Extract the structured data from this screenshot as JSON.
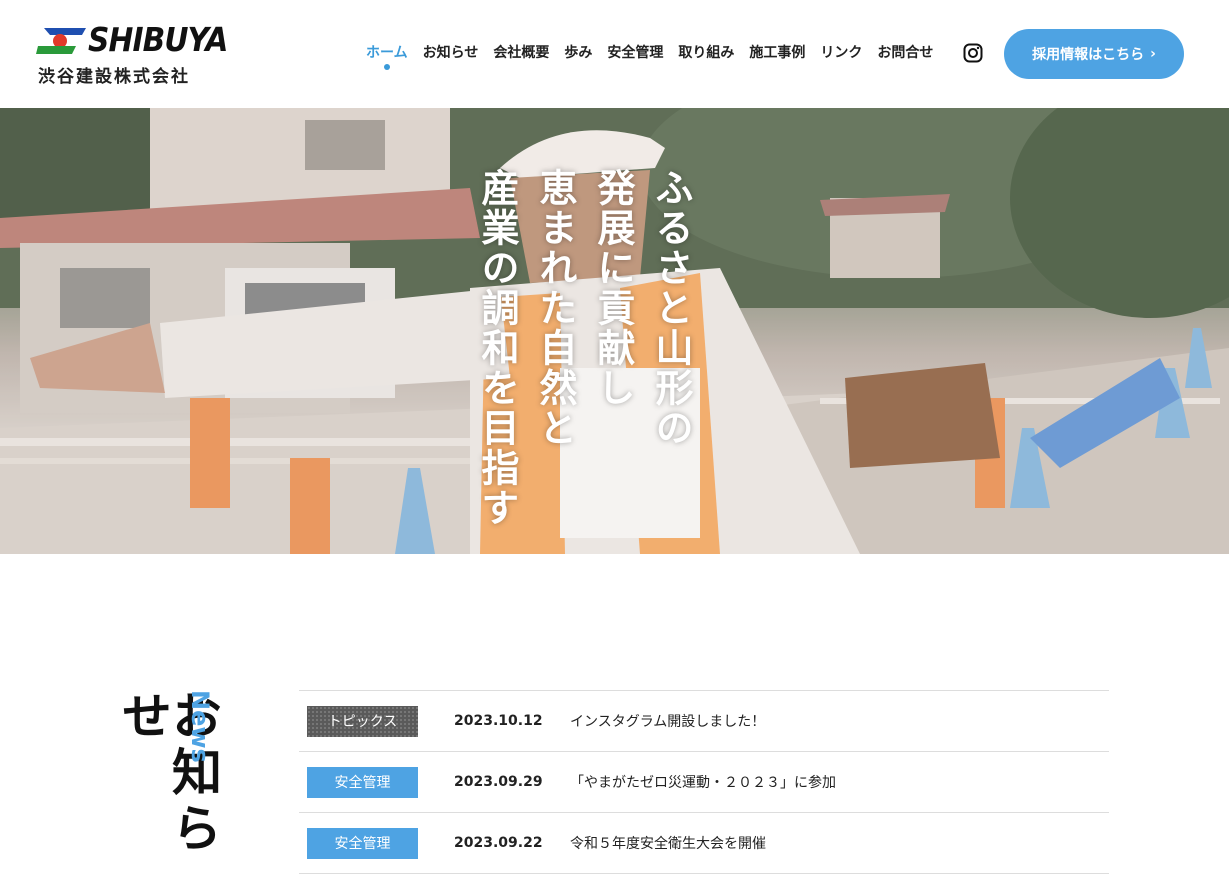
{
  "brand": {
    "logo_word": "SHIBUYA",
    "logo_jp": "渋谷建設株式会社"
  },
  "nav": {
    "items": [
      {
        "label": "ホーム",
        "active": true
      },
      {
        "label": "お知らせ"
      },
      {
        "label": "会社概要"
      },
      {
        "label": "歩み"
      },
      {
        "label": "安全管理"
      },
      {
        "label": "取り組み"
      },
      {
        "label": "施工事例"
      },
      {
        "label": "リンク"
      },
      {
        "label": "お問合せ"
      }
    ],
    "instagram_icon": "instagram-icon",
    "recruit_label": "採用情報はこちら",
    "recruit_arrow": "›"
  },
  "hero": {
    "lines": [
      "ふるさと山形の",
      "発展に貢献し",
      "恵まれた自然と",
      "産業の調和を目指す"
    ]
  },
  "news": {
    "heading_jp": "お知らせ",
    "heading_en": "News",
    "items": [
      {
        "category": "トピックス",
        "date": "2023.10.12",
        "title": "インスタグラム開設しました！"
      },
      {
        "category": "安全管理",
        "date": "2023.09.29",
        "title": "「やまがたゼロ災運動・２０２３」に参加"
      },
      {
        "category": "安全管理",
        "date": "2023.09.22",
        "title": "令和５年度安全衛生大会を開催"
      }
    ]
  },
  "colors": {
    "accent": "#4ea3e3",
    "topics_badge": "#5a5a5a"
  }
}
